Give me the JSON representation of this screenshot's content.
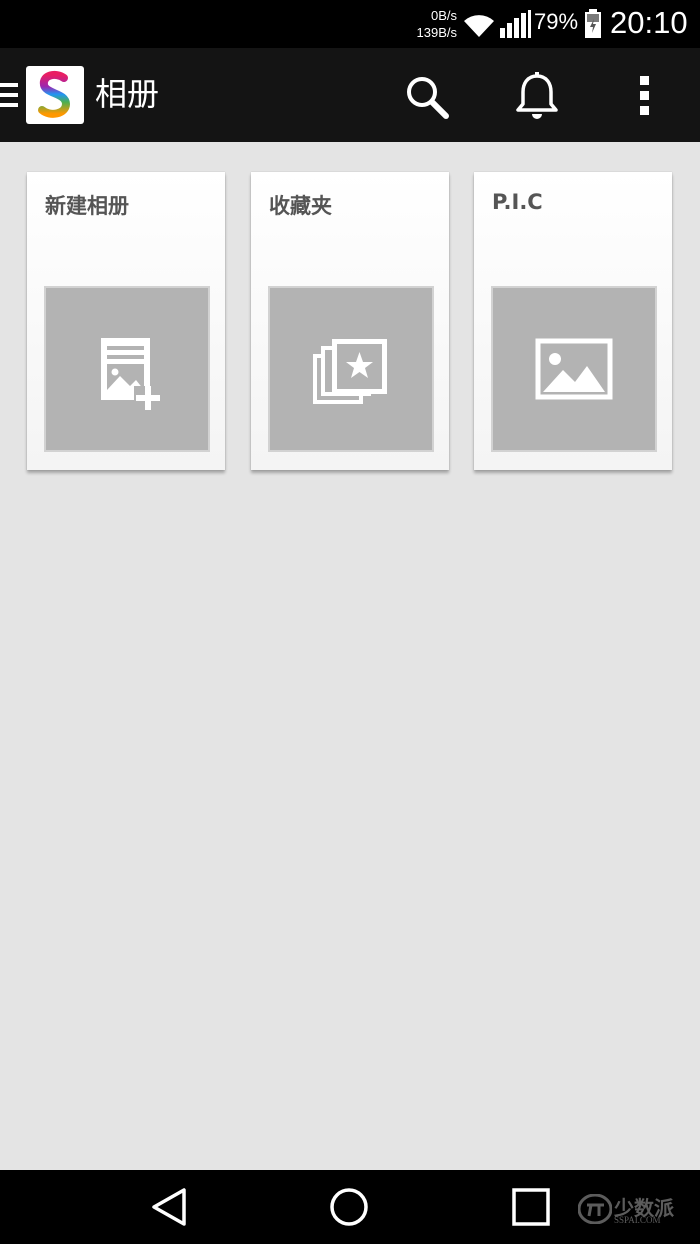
{
  "status_bar": {
    "net_up": "0B/s",
    "net_down": "139B/s",
    "battery_percent": "79%",
    "time": "20:10"
  },
  "app_bar": {
    "title": "相册",
    "icons": [
      "menu-icon",
      "app-logo",
      "search-icon",
      "bell-icon",
      "more-vert-icon"
    ]
  },
  "albums": [
    {
      "title": "新建相册",
      "icon": "new-album-icon"
    },
    {
      "title": "收藏夹",
      "icon": "favorites-icon"
    },
    {
      "title": "P.I.C",
      "icon": "image-icon"
    }
  ],
  "nav_bar": {
    "icons": [
      "back-icon",
      "home-icon",
      "recents-icon"
    ]
  },
  "watermark": {
    "main": "少数派",
    "sub": "SSPAI.COM"
  }
}
